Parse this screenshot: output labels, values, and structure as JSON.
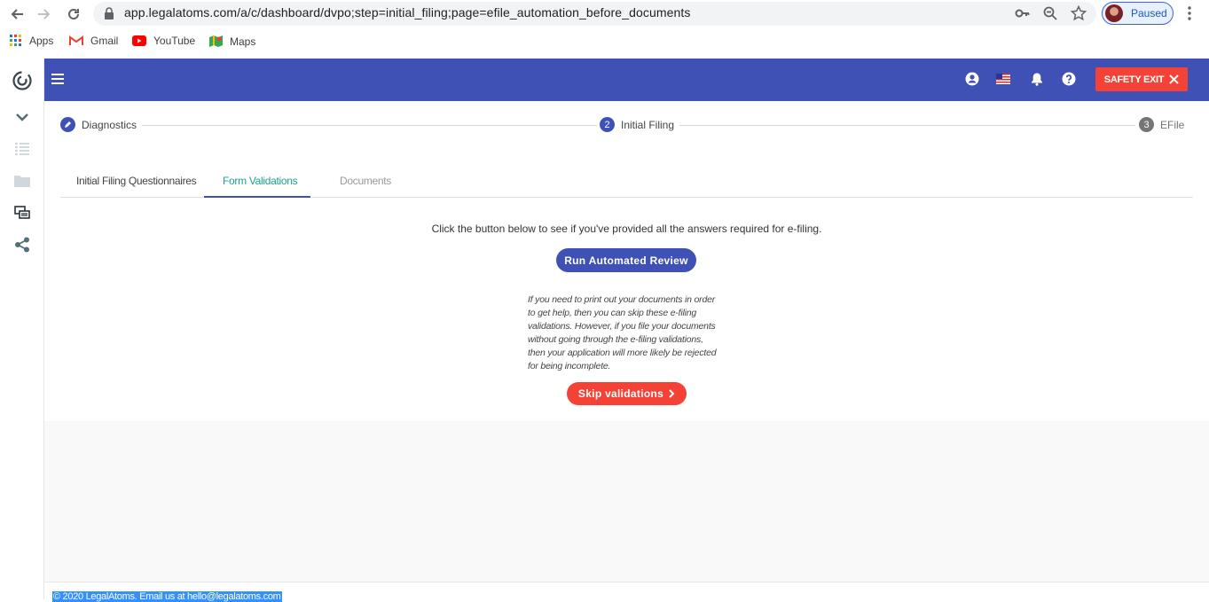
{
  "browser": {
    "url": "app.legalatoms.com/a/c/dashboard/dvpo;step=initial_filing;page=efile_automation_before_documents",
    "profile_status": "Paused",
    "bookmarks": [
      {
        "label": "Apps",
        "icon": "apps-grid-icon"
      },
      {
        "label": "Gmail",
        "icon": "gmail-icon"
      },
      {
        "label": "YouTube",
        "icon": "youtube-icon"
      },
      {
        "label": "Maps",
        "icon": "maps-icon"
      }
    ]
  },
  "topbar": {
    "safety_exit_label": "SAFETY EXIT",
    "accent": "#3f51b5",
    "danger": "#f44336"
  },
  "stepper": {
    "steps": [
      {
        "label": "Diagnostics",
        "marker": "",
        "state": "completed"
      },
      {
        "label": "Initial Filing",
        "marker": "2",
        "state": "active"
      },
      {
        "label": "EFile",
        "marker": "3",
        "state": "pending"
      }
    ]
  },
  "tabs": [
    {
      "label": "Initial Filing Questionnaires",
      "state": "normal"
    },
    {
      "label": "Form Validations",
      "state": "active"
    },
    {
      "label": "Documents",
      "state": "disabled"
    }
  ],
  "main": {
    "prompt": "Click the button below to see if you've provided all the answers required for e-filing.",
    "run_button": "Run Automated Review",
    "note_lines": [
      "If you need to print out your documents in order",
      "to get help, then you can skip these e-filing",
      "validations. However, if you file your documents",
      "without going through the e-filing validations,",
      "then your application will more likely be rejected",
      "for being incomplete."
    ],
    "skip_button": "Skip validations"
  },
  "footer": {
    "text": "© 2020 LegalAtoms. Email us at hello@legalatoms.com"
  }
}
